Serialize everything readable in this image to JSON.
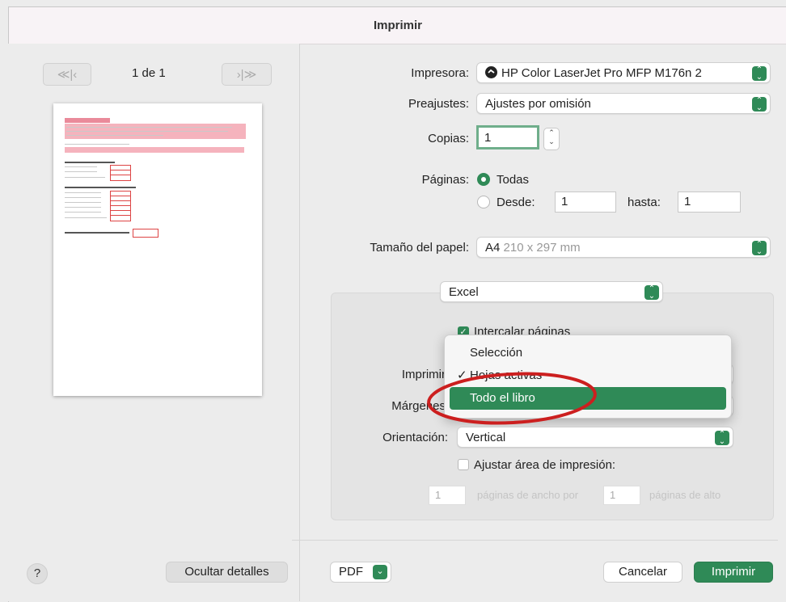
{
  "window": {
    "title": "Imprimir"
  },
  "preview": {
    "nav_first": "≪|‹",
    "nav_last": "›|≫",
    "page_indicator": "1 de 1"
  },
  "printer": {
    "label": "Impresora:",
    "value": "HP Color LaserJet Pro MFP M176n 2",
    "icon": "printer-status-icon"
  },
  "presets": {
    "label": "Preajustes:",
    "value": "Ajustes por omisión"
  },
  "copies": {
    "label": "Copias:",
    "value": "1"
  },
  "pages": {
    "label": "Páginas:",
    "all_label": "Todas",
    "from_label": "Desde:",
    "from_value": "1",
    "to_label": "hasta:",
    "to_value": "1"
  },
  "paper": {
    "label": "Tamaño del papel:",
    "value": "A4",
    "dims": "210 x 297 mm"
  },
  "app_section": {
    "value": "Excel"
  },
  "collate": {
    "label": "Intercalar páginas"
  },
  "print_what": {
    "label": "Imprimir"
  },
  "margins": {
    "label": "Márgenes"
  },
  "menu": {
    "items": [
      {
        "label": "Selección",
        "checked": false,
        "highlighted": false
      },
      {
        "label": "Hojas activas",
        "checked": true,
        "highlighted": false
      },
      {
        "label": "Todo el libro",
        "checked": false,
        "highlighted": true
      }
    ]
  },
  "orientation": {
    "label": "Orientación:",
    "value": "Vertical"
  },
  "fit": {
    "label": "Ajustar área de impresión:",
    "wide_value": "1",
    "wide_label": "páginas de ancho por",
    "tall_value": "1",
    "tall_label": "páginas de alto"
  },
  "footer": {
    "help": "?",
    "hide_details": "Ocultar detalles",
    "pdf": "PDF",
    "cancel": "Cancelar",
    "print": "Imprimir"
  },
  "colors": {
    "accent": "#2f8a57",
    "annotation": "#cc1f1f"
  }
}
